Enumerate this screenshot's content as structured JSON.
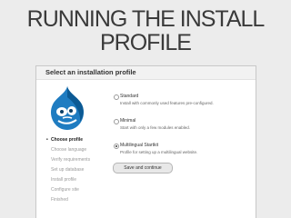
{
  "slide": {
    "title_line1": "RUNNING THE INSTALL",
    "title_line2": "PROFILE"
  },
  "installer": {
    "heading": "Select an installation profile",
    "steps": [
      "Choose profile",
      "Choose language",
      "Verify requirements",
      "Set up database",
      "Install profile",
      "Configure site",
      "Finished"
    ],
    "active_step": "Choose profile",
    "profiles": [
      {
        "label": "Standard",
        "description": "Install with commonly used features pre-configured.",
        "selected": false
      },
      {
        "label": "Minimal",
        "description": "Start with only a few modules enabled.",
        "selected": false
      },
      {
        "label": "Multilingual Startkit",
        "description": "Profile for setting up a multilingual website.",
        "selected": true
      }
    ],
    "submit_label": "Save and continue",
    "logo": "drupal-logo"
  },
  "colors": {
    "slide_bg": "#ececec",
    "logo_blue": "#1f7cc1",
    "logo_dark": "#0c5a94"
  }
}
